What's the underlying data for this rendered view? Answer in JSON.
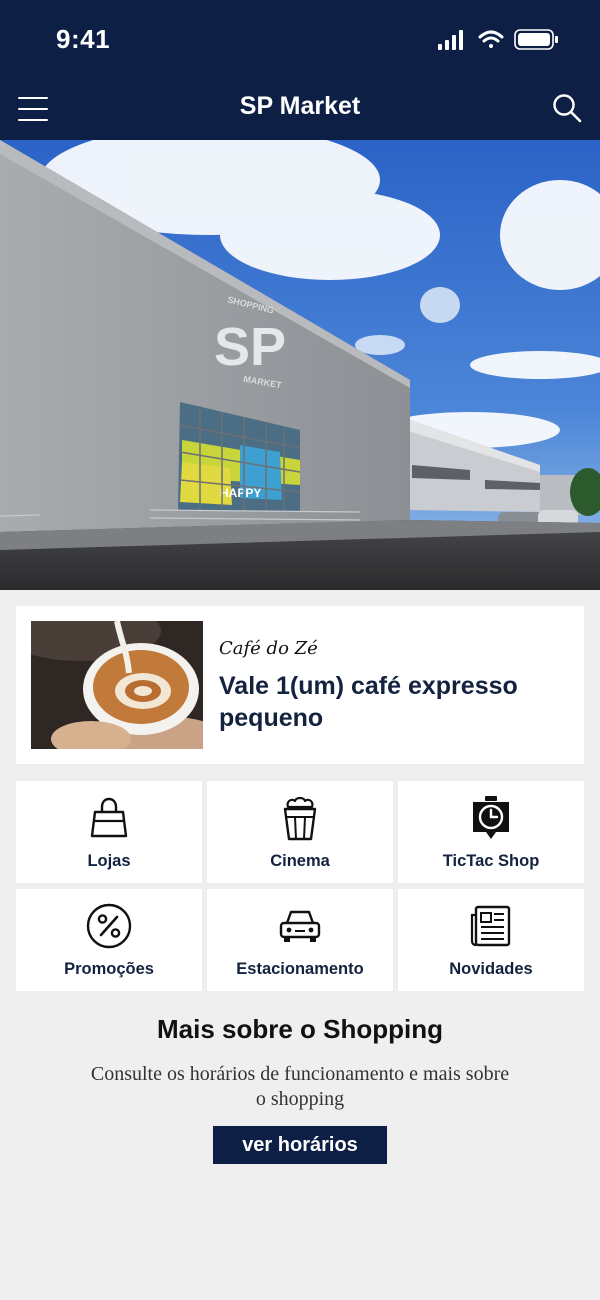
{
  "status_bar": {
    "time": "9:41",
    "icons": [
      "signal-icon",
      "wifi-icon",
      "battery-icon"
    ]
  },
  "header": {
    "title": "SP Market",
    "left_icon": "menu-icon",
    "right_icon": "search-icon",
    "background_color": "#0e1f45"
  },
  "hero": {
    "building_logo_top": "SHOPPING",
    "building_logo_main": "SP",
    "building_logo_bottom": "MARKET",
    "window_sign": "HAPPY"
  },
  "promo": {
    "brand": "Café do Zé",
    "offer": "Vale 1(um) café expresso pequeno"
  },
  "categories": [
    {
      "label": "Lojas",
      "icon": "shopping-bag-icon"
    },
    {
      "label": "Cinema",
      "icon": "popcorn-icon"
    },
    {
      "label": "TicTac Shop",
      "icon": "clock-icon"
    },
    {
      "label": "Promoções",
      "icon": "percent-icon"
    },
    {
      "label": "Estacionamento",
      "icon": "car-icon"
    },
    {
      "label": "Novidades",
      "icon": "newspaper-icon"
    }
  ],
  "more": {
    "title": "Mais sobre o Shopping",
    "description": "Consulte os horários de funcionamento e mais sobre o shopping",
    "button_label": "ver horários"
  },
  "colors": {
    "primary": "#0e1f45",
    "page_background": "#efefef",
    "card_background": "#ffffff"
  }
}
